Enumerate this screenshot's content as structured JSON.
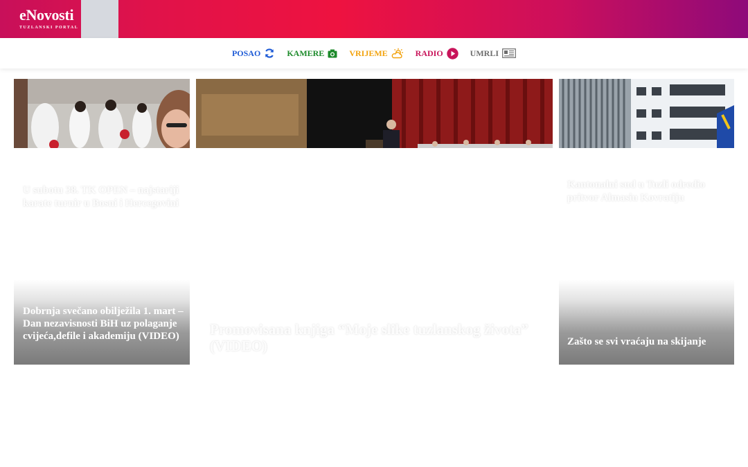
{
  "header": {
    "logo_title": "eNovosti",
    "logo_subtitle": "TUZLANSKI PORTAL",
    "gradient_colors": [
      "#c8105a",
      "#ee1240",
      "#8e0a7a"
    ]
  },
  "nav": {
    "posao": "POSAO",
    "kamere": "KAMERE",
    "vrijeme": "VRIJEME",
    "radio": "RADIO",
    "umrli": "UMRLI",
    "colors": {
      "posao": "#1e5bd6",
      "kamere": "#1c8a2a",
      "vrijeme": "#f2a20c",
      "radio": "#c8145a",
      "umrli": "#6d6d6d"
    }
  },
  "articles": {
    "karate": "U subotu 38. TK OPEN – najstariji karate turnir u Bosni i Hercegovini",
    "promovisana": "Promovisana knjiga “Moje slike tuzlanskog života” (VIDEO)",
    "kantonalni": "Kantonalni sud u Tuzli odredio pritvor Almasiu Kovratiju",
    "dobrnja": "Dobrnja svečano obilježila 1. mart – Dan nezavisnosti BiH uz polaganje cvijeća,defile i akademiju (VIDEO)",
    "skijanje": "Zašto se svi vraćaju na skijanje"
  }
}
